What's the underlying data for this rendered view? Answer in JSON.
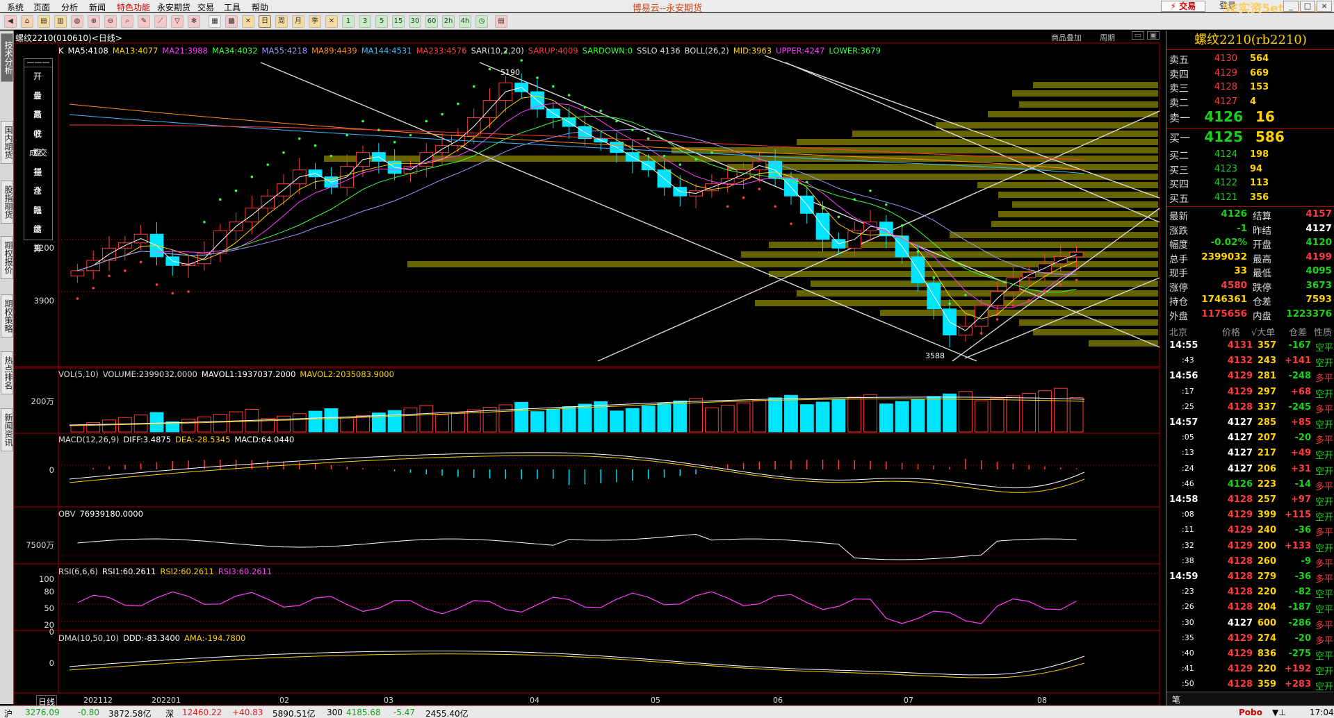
{
  "menu": [
    "系统",
    "页面",
    "分析",
    "新闻",
    "特色功能",
    "永安期货",
    "交易",
    "工具",
    "帮助"
  ],
  "app_title": "博易云--永安期货",
  "trade_button": "交易",
  "login_button": "登录",
  "watermark": "5E实资5etz.com",
  "window_controls": [
    "_",
    "□",
    "×"
  ],
  "side_tabs": [
    "技术分析",
    "国内期货",
    "股指期货",
    "期权报价",
    "期权策略",
    "热点排名",
    "新闻资讯"
  ],
  "chart": {
    "title": "螺纹2210(010610)<日线>",
    "top_right_links": [
      "商品叠加",
      "周期"
    ],
    "info_panel": {
      "header": "———",
      "rows": [
        "开盘",
        "最高",
        "最低",
        "收盘",
        "成交量",
        "持仓",
        "涨跌",
        "幅度",
        "结算"
      ]
    },
    "main_indicator_labels": [
      {
        "text": "K",
        "color": "#ffffff"
      },
      {
        "text": "MA5:4108",
        "color": "#ffffff"
      },
      {
        "text": "MA13:4077",
        "color": "#ffd200"
      },
      {
        "text": "MA21:3988",
        "color": "#ff3cff"
      },
      {
        "text": "MA34:4032",
        "color": "#3cff3c"
      },
      {
        "text": "MA55:4218",
        "color": "#9999ff"
      },
      {
        "text": "MA89:4439",
        "color": "#ff8c1a"
      },
      {
        "text": "MA144:4531",
        "color": "#3cbcff"
      },
      {
        "text": "MA233:4576",
        "color": "#ff3c3c"
      },
      {
        "text": "SAR(10,2,20)",
        "color": "#dddddd"
      },
      {
        "text": "SARUP:4009",
        "color": "#ff3c3c"
      },
      {
        "text": "SARDOWN:0",
        "color": "#3cff3c"
      },
      {
        "text": "SSLO 4136",
        "color": "#dddddd"
      },
      {
        "text": "BOLL(26,2)",
        "color": "#dddddd"
      },
      {
        "text": "MID:3963",
        "color": "#ffd200"
      },
      {
        "text": "UPPER:4247",
        "color": "#ff3cff"
      },
      {
        "text": "LOWER:3679",
        "color": "#3cff3c"
      }
    ],
    "price_ticks": [
      "4200",
      "3900"
    ],
    "high_label": "5190",
    "low_label": "3588",
    "volume": {
      "labels": [
        {
          "text": "VOL(5,10)",
          "color": "#dddddd"
        },
        {
          "text": "VOLUME:2399032.0000",
          "color": "#dddddd"
        },
        {
          "text": "MAVOL1:1937037.2000",
          "color": "#ffffff"
        },
        {
          "text": "MAVOL2:2035083.9000",
          "color": "#ffd200"
        }
      ],
      "tick": "200万"
    },
    "macd": {
      "labels": [
        {
          "text": "MACD(12,26,9)",
          "color": "#dddddd"
        },
        {
          "text": "DIFF:3.4875",
          "color": "#ffffff"
        },
        {
          "text": "DEA:-28.5345",
          "color": "#ffd200"
        },
        {
          "text": "MACD:64.0440",
          "color": "#ffffff"
        }
      ],
      "tick": "0"
    },
    "obv": {
      "labels": [
        {
          "text": "OBV",
          "color": "#dddddd"
        },
        {
          "text": "76939180.0000",
          "color": "#ffffff"
        }
      ],
      "tick": "7500万"
    },
    "rsi": {
      "labels": [
        {
          "text": "RSI(6,6,6)",
          "color": "#dddddd"
        },
        {
          "text": "RSI1:60.2611",
          "color": "#ffffff"
        },
        {
          "text": "RSI2:60.2611",
          "color": "#ffd200"
        },
        {
          "text": "RSI3:60.2611",
          "color": "#ff3cff"
        }
      ],
      "ticks": [
        "100",
        "80",
        "50",
        "20",
        "0"
      ]
    },
    "dma": {
      "labels": [
        {
          "text": "DMA(10,50,10)",
          "color": "#dddddd"
        },
        {
          "text": "DDD:-83.3400",
          "color": "#ffffff"
        },
        {
          "text": "AMA:-194.7800",
          "color": "#ffd200"
        }
      ],
      "tick": "0"
    },
    "x_axis": {
      "period_label": "日线",
      "labels": [
        "202112",
        "202201",
        "02",
        "03",
        "04",
        "05",
        "06",
        "07",
        "08"
      ]
    }
  },
  "chart_data": {
    "type": "candlestick",
    "symbol": "螺纹2210",
    "approx_closes": [
      4020,
      4080,
      4150,
      4180,
      4230,
      4100,
      4050,
      4060,
      4120,
      4250,
      4300,
      4380,
      4450,
      4520,
      4600,
      4560,
      4500,
      4620,
      4700,
      4650,
      4580,
      4620,
      4700,
      4740,
      4800,
      4900,
      5000,
      5100,
      5050,
      4950,
      4900,
      4850,
      4780,
      4760,
      4700,
      4650,
      4600,
      4500,
      4450,
      4480,
      4520,
      4550,
      4600,
      4650,
      4550,
      4450,
      4350,
      4200,
      4150,
      4250,
      4300,
      4220,
      4100,
      3950,
      3800,
      3650,
      3700,
      3820,
      3900,
      3980,
      4010,
      4060,
      4100,
      4126
    ],
    "high": 5190,
    "low": 3588,
    "last": 4126
  },
  "quote": {
    "title": "螺纹2210(rb2210)",
    "asks": [
      {
        "label": "卖五",
        "price": "4130",
        "vol": "564"
      },
      {
        "label": "卖四",
        "price": "4129",
        "vol": "669"
      },
      {
        "label": "卖三",
        "price": "4128",
        "vol": "153"
      },
      {
        "label": "卖二",
        "price": "4127",
        "vol": "4"
      },
      {
        "label": "卖一",
        "price": "4126",
        "vol": "16"
      }
    ],
    "bids": [
      {
        "label": "买一",
        "price": "4125",
        "vol": "586"
      },
      {
        "label": "买二",
        "price": "4124",
        "vol": "198"
      },
      {
        "label": "买三",
        "price": "4123",
        "vol": "94"
      },
      {
        "label": "买四",
        "price": "4122",
        "vol": "113"
      },
      {
        "label": "买五",
        "price": "4121",
        "vol": "356"
      }
    ],
    "stats": [
      {
        "k1": "最新",
        "v1": "4126",
        "c1": "green",
        "k2": "结算",
        "v2": "4157",
        "c2": "red"
      },
      {
        "k1": "涨跌",
        "v1": "-1",
        "c1": "green",
        "k2": "昨结",
        "v2": "4127",
        "c2": "white"
      },
      {
        "k1": "幅度",
        "v1": "-0.02%",
        "c1": "green",
        "k2": "开盘",
        "v2": "4120",
        "c2": "green"
      },
      {
        "k1": "总手",
        "v1": "2399032",
        "c1": "yellow",
        "k2": "最高",
        "v2": "4199",
        "c2": "red"
      },
      {
        "k1": "现手",
        "v1": "33",
        "c1": "yellow",
        "k2": "最低",
        "v2": "4095",
        "c2": "green"
      },
      {
        "k1": "涨停",
        "v1": "4580",
        "c1": "red",
        "k2": "跌停",
        "v2": "3673",
        "c2": "green"
      },
      {
        "k1": "持仓",
        "v1": "1746361",
        "c1": "yellow",
        "k2": "仓差",
        "v2": "7593",
        "c2": "yellow"
      },
      {
        "k1": "外盘",
        "v1": "1175656",
        "c1": "red",
        "k2": "内盘",
        "v2": "1223376",
        "c2": "green"
      }
    ],
    "tick_header": [
      "北京",
      "价格",
      "√大单",
      "仓差",
      "性质"
    ],
    "ticks": [
      {
        "time": "14:55",
        "big": true,
        "price": "4131",
        "pc": "red",
        "qty": "357",
        "delta": "-167",
        "dc": "green",
        "nature": "空平",
        "nc": "green"
      },
      {
        "time": ":43",
        "big": false,
        "price": "4132",
        "pc": "red",
        "qty": "243",
        "delta": "+141",
        "dc": "red",
        "nature": "空开",
        "nc": "green"
      },
      {
        "time": "14:56",
        "big": true,
        "price": "4129",
        "pc": "red",
        "qty": "281",
        "delta": "-248",
        "dc": "green",
        "nature": "多平",
        "nc": "red"
      },
      {
        "time": ":17",
        "big": false,
        "price": "4129",
        "pc": "red",
        "qty": "297",
        "delta": "+68",
        "dc": "red",
        "nature": "空开",
        "nc": "green"
      },
      {
        "time": ":25",
        "big": false,
        "price": "4128",
        "pc": "red",
        "qty": "337",
        "delta": "-245",
        "dc": "green",
        "nature": "多平",
        "nc": "red"
      },
      {
        "time": "14:57",
        "big": true,
        "price": "4127",
        "pc": "white",
        "qty": "285",
        "delta": "+85",
        "dc": "red",
        "nature": "空开",
        "nc": "green"
      },
      {
        "time": ":05",
        "big": false,
        "price": "4127",
        "pc": "white",
        "qty": "207",
        "delta": "-20",
        "dc": "green",
        "nature": "多平",
        "nc": "red"
      },
      {
        "time": ":13",
        "big": false,
        "price": "4127",
        "pc": "white",
        "qty": "217",
        "delta": "+49",
        "dc": "red",
        "nature": "空开",
        "nc": "green"
      },
      {
        "time": ":24",
        "big": false,
        "price": "4127",
        "pc": "white",
        "qty": "206",
        "delta": "+31",
        "dc": "red",
        "nature": "空开",
        "nc": "green"
      },
      {
        "time": ":46",
        "big": false,
        "price": "4126",
        "pc": "green",
        "qty": "223",
        "delta": "-14",
        "dc": "green",
        "nature": "多平",
        "nc": "red"
      },
      {
        "time": "14:58",
        "big": true,
        "price": "4128",
        "pc": "red",
        "qty": "257",
        "delta": "+97",
        "dc": "red",
        "nature": "空开",
        "nc": "green"
      },
      {
        "time": ":08",
        "big": false,
        "price": "4129",
        "pc": "red",
        "qty": "399",
        "delta": "+115",
        "dc": "red",
        "nature": "空开",
        "nc": "green"
      },
      {
        "time": ":11",
        "big": false,
        "price": "4129",
        "pc": "red",
        "qty": "240",
        "delta": "-36",
        "dc": "green",
        "nature": "多平",
        "nc": "red"
      },
      {
        "time": ":32",
        "big": false,
        "price": "4129",
        "pc": "red",
        "qty": "200",
        "delta": "+133",
        "dc": "red",
        "nature": "空开",
        "nc": "green"
      },
      {
        "time": ":38",
        "big": false,
        "price": "4128",
        "pc": "red",
        "qty": "260",
        "delta": "-9",
        "dc": "green",
        "nature": "多平",
        "nc": "red"
      },
      {
        "time": "14:59",
        "big": true,
        "price": "4128",
        "pc": "red",
        "qty": "279",
        "delta": "-36",
        "dc": "green",
        "nature": "多平",
        "nc": "red"
      },
      {
        "time": ":23",
        "big": false,
        "price": "4128",
        "pc": "red",
        "qty": "220",
        "delta": "-82",
        "dc": "green",
        "nature": "空平",
        "nc": "green"
      },
      {
        "time": ":26",
        "big": false,
        "price": "4128",
        "pc": "red",
        "qty": "204",
        "delta": "-187",
        "dc": "green",
        "nature": "空平",
        "nc": "green"
      },
      {
        "time": ":30",
        "big": false,
        "price": "4127",
        "pc": "white",
        "qty": "600",
        "delta": "-286",
        "dc": "green",
        "nature": "多平",
        "nc": "red"
      },
      {
        "time": ":35",
        "big": false,
        "price": "4129",
        "pc": "red",
        "qty": "274",
        "delta": "-20",
        "dc": "green",
        "nature": "多平",
        "nc": "red"
      },
      {
        "time": ":40",
        "big": false,
        "price": "4129",
        "pc": "red",
        "qty": "836",
        "delta": "-275",
        "dc": "green",
        "nature": "空平",
        "nc": "green"
      },
      {
        "time": ":41",
        "big": false,
        "price": "4129",
        "pc": "red",
        "qty": "220",
        "delta": "+192",
        "dc": "red",
        "nature": "空开",
        "nc": "green"
      },
      {
        "time": ":50",
        "big": false,
        "price": "4128",
        "pc": "red",
        "qty": "359",
        "delta": "+283",
        "dc": "red",
        "nature": "空开",
        "nc": "green"
      }
    ],
    "footer_tab": "笔"
  },
  "status": {
    "items": [
      {
        "text": "沪",
        "color": "#000000"
      },
      {
        "text": "3276.09",
        "color": "#19a019"
      },
      {
        "text": "-0.80",
        "color": "#19a019"
      },
      {
        "text": "3872.58亿",
        "color": "#000000"
      },
      {
        "text": "深",
        "color": "#000000"
      },
      {
        "text": "12460.22",
        "color": "#e02020"
      },
      {
        "text": "+40.83",
        "color": "#e02020"
      },
      {
        "text": "5890.51亿",
        "color": "#000000"
      },
      {
        "text": "300",
        "color": "#000000"
      },
      {
        "text": "4185.68",
        "color": "#19a019"
      },
      {
        "text": "-5.47",
        "color": "#19a019"
      },
      {
        "text": "2455.40亿",
        "color": "#000000"
      }
    ],
    "brand": "Pobo",
    "clock": "17:04"
  }
}
